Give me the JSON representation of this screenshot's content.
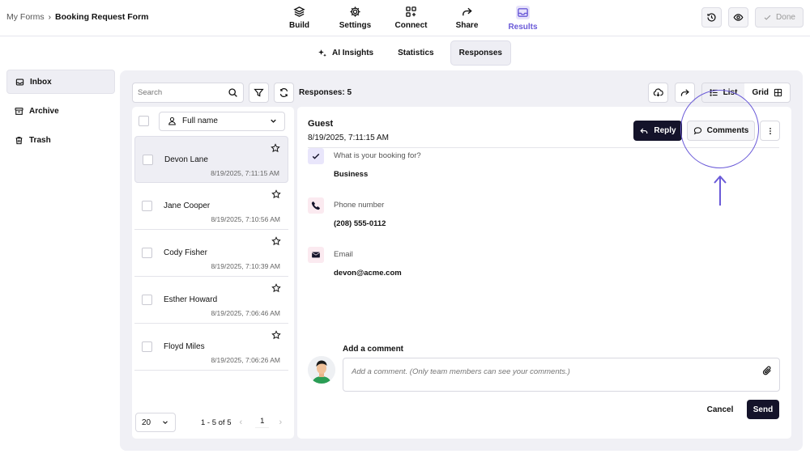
{
  "breadcrumb": {
    "parent": "My Forms",
    "separator": "›",
    "current": "Booking Request Form"
  },
  "nav": {
    "tabs": [
      {
        "label": "Build",
        "icon": "layers-icon"
      },
      {
        "label": "Settings",
        "icon": "gear-icon"
      },
      {
        "label": "Connect",
        "icon": "integrations-icon"
      },
      {
        "label": "Share",
        "icon": "share-arrow-icon"
      },
      {
        "label": "Results",
        "icon": "inbox-tray-icon",
        "active": true
      }
    ]
  },
  "top_actions": {
    "done_label": "Done"
  },
  "subtabs": [
    {
      "label": "AI Insights",
      "icon": "sparkle-icon"
    },
    {
      "label": "Statistics"
    },
    {
      "label": "Responses",
      "active": true
    }
  ],
  "sidebar": {
    "items": [
      {
        "label": "Inbox",
        "icon": "inbox-icon",
        "active": true
      },
      {
        "label": "Archive",
        "icon": "archive-icon"
      },
      {
        "label": "Trash",
        "icon": "trash-icon"
      }
    ]
  },
  "toolbar": {
    "search_placeholder": "Search",
    "responses_count": "Responses: 5",
    "view_list": "List",
    "view_grid": "Grid"
  },
  "list": {
    "sort_label": "Full name",
    "rows": [
      {
        "name": "Devon Lane",
        "date": "8/19/2025, 7:11:15 AM",
        "selected": true
      },
      {
        "name": "Jane Cooper",
        "date": "8/19/2025, 7:10:56 AM"
      },
      {
        "name": "Cody Fisher",
        "date": "8/19/2025, 7:10:39 AM"
      },
      {
        "name": "Esther Howard",
        "date": "8/19/2025, 7:06:46 AM"
      },
      {
        "name": "Floyd Miles",
        "date": "8/19/2025, 7:06:26 AM"
      }
    ],
    "per_page": "20",
    "range": "1 - 5 of 5",
    "page": "1",
    "prev": "‹",
    "next": "›"
  },
  "detail": {
    "title": "Guest",
    "date": "8/19/2025, 7:11:15 AM",
    "reply_label": "Reply",
    "comments_label": "Comments",
    "fields": [
      {
        "question": "What is your booking for?",
        "answer": "Business",
        "icon": "check-icon",
        "color": "#e9e6fb"
      },
      {
        "question": "Phone number",
        "answer": "(208) 555-0112",
        "icon": "phone-icon",
        "color": "#fbeaf0"
      },
      {
        "question": "Email",
        "answer": "devon@acme.com",
        "icon": "mail-icon",
        "color": "#fbeaf0"
      }
    ],
    "comment_label": "Add a comment",
    "comment_placeholder": "Add a comment. (Only team members can see your comments.)",
    "cancel_label": "Cancel",
    "send_label": "Send"
  },
  "colors": {
    "accent": "#6a5ad8",
    "dark_button": "#14132a",
    "panel_bg": "#f0f0f5"
  }
}
